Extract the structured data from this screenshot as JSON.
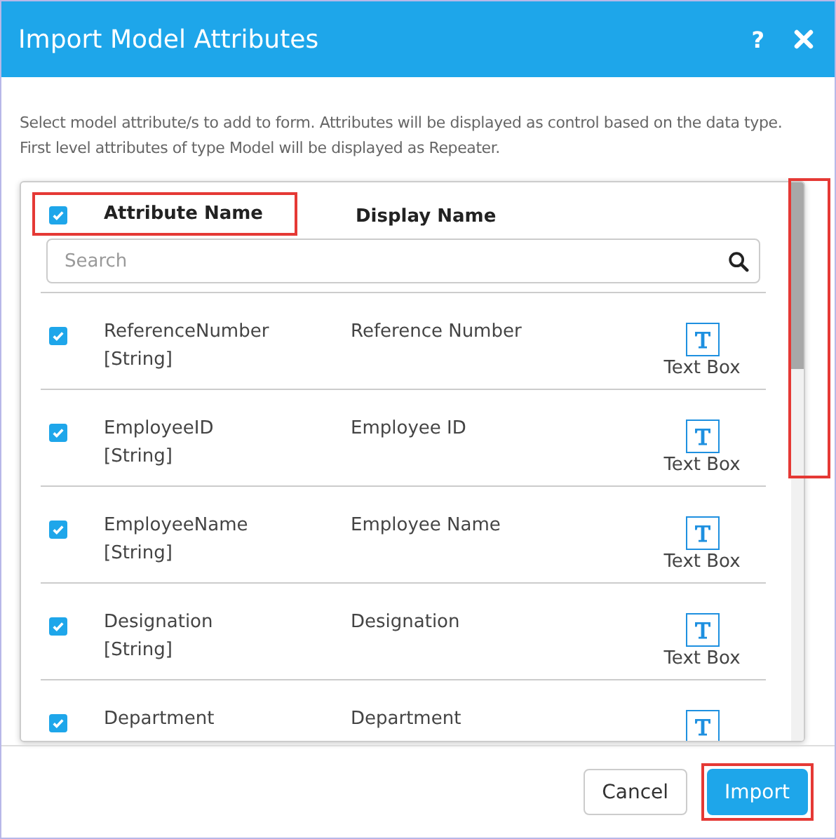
{
  "dialog": {
    "title": "Import Model Attributes",
    "help_label": "?"
  },
  "description": "Select model attribute/s to add to form. Attributes will be displayed as control based on the data type. First level attributes of type Model will be displayed as Repeater.",
  "table": {
    "select_all": {
      "checked": true
    },
    "header_highlighted": true,
    "columns": [
      {
        "label": "Attribute Name"
      },
      {
        "label": "Display Name"
      }
    ],
    "search": {
      "placeholder": "Search"
    },
    "scrollbar_highlighted": true,
    "rows": [
      {
        "attribute": "ReferenceNumber",
        "type": "[String]",
        "display_name": "Reference Number",
        "control": "Text Box",
        "checked": true
      },
      {
        "attribute": "EmployeeID",
        "type": "[String]",
        "display_name": "Employee ID",
        "control": "Text Box",
        "checked": true
      },
      {
        "attribute": "EmployeeName",
        "type": "[String]",
        "display_name": "Employee Name",
        "control": "Text Box",
        "checked": true
      },
      {
        "attribute": "Designation",
        "type": "[String]",
        "display_name": "Designation",
        "control": "Text Box",
        "checked": true
      },
      {
        "attribute": "Department",
        "display_name": "Department",
        "checked": true
      }
    ]
  },
  "buttons": [
    {
      "label": "Cancel",
      "kind": "secondary",
      "highlighted": false
    },
    {
      "label": "Import",
      "kind": "primary",
      "highlighted": true
    }
  ]
}
